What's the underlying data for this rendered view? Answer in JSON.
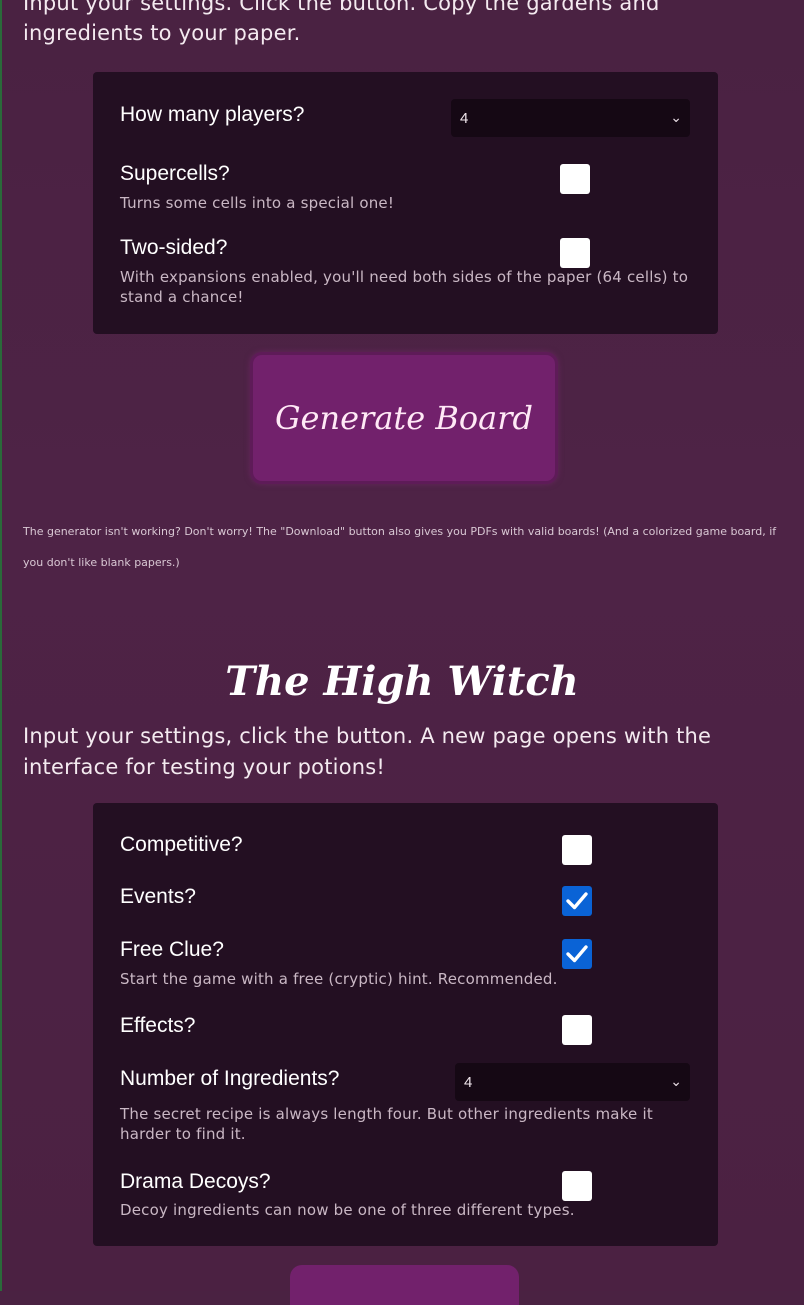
{
  "gardens": {
    "intro": "Input your settings. Click the button. Copy the gardens and ingredients to your paper.",
    "players_label": "How many players?",
    "players_value": "4",
    "supercells_label": "Supercells?",
    "supercells_desc": "Turns some cells into a special one!",
    "supercells_checked": false,
    "two_sided_label": "Two-sided?",
    "two_sided_desc": "With expansions enabled, you'll need both sides of the paper (64 cells) to stand a chance!",
    "two_sided_checked": false,
    "generate_label": "Generate Board",
    "note": "The generator isn't working? Don't worry! The \"Download\" button also gives you PDFs with valid boards! (And a colorized game board, if you don't like blank papers.)"
  },
  "high_witch": {
    "title": "The High Witch",
    "intro": "Input your settings, click the button. A new page opens with the interface for testing your potions!",
    "competitive_label": "Competitive?",
    "competitive_checked": false,
    "events_label": "Events?",
    "events_checked": true,
    "free_clue_label": "Free Clue?",
    "free_clue_desc": "Start the game with a free (cryptic) hint. Recommended.",
    "free_clue_checked": true,
    "effects_label": "Effects?",
    "effects_checked": false,
    "ingredients_label": "Number of Ingredients?",
    "ingredients_value": "4",
    "ingredients_desc": "The secret recipe is always length four. But other ingredients make it harder to find it.",
    "drama_label": "Drama Decoys?",
    "drama_desc": "Decoy ingredients can now be one of three different types.",
    "drama_checked": false
  },
  "colors": {
    "background": "#4a2242",
    "panel": "#230f22",
    "button": "#72216c",
    "checkbox_checked": "#0a63d6"
  },
  "icons": [
    "chevron-down-icon",
    "checkmark-icon"
  ]
}
